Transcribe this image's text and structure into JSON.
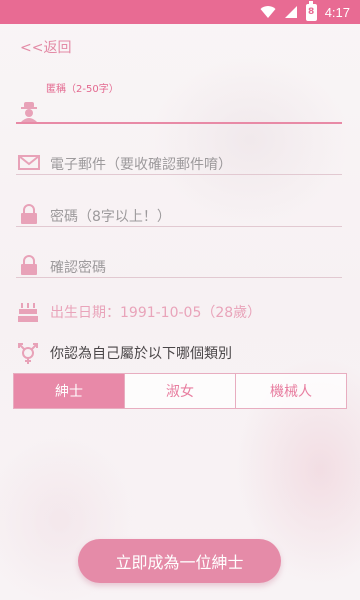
{
  "status_bar": {
    "time": "4:17",
    "battery_label": "8"
  },
  "nav": {
    "back_label": "<<返回"
  },
  "form": {
    "nickname_label": "匿稱（2-50字）",
    "email_placeholder": "電子郵件（要收確認郵件唷）",
    "password_placeholder": "密碼（8字以上！）",
    "confirm_password_placeholder": "確認密碼",
    "birthdate": "出生日期：1991-10-05（28歲）",
    "gender_question": "你認為自己屬於以下哪個類別",
    "gender_options": [
      "紳士",
      "淑女",
      "機械人"
    ],
    "selected_gender": "紳士"
  },
  "submit_label": "立即成為一位紳士",
  "colors": {
    "accent": "#e86b93",
    "button": "#e58ba8",
    "icon": "#e8a2b8"
  },
  "icons": [
    "wifi-icon",
    "signal-icon",
    "battery-icon",
    "user-icon",
    "mail-icon",
    "lock-icon",
    "birthday-cake-icon",
    "gender-icon"
  ]
}
